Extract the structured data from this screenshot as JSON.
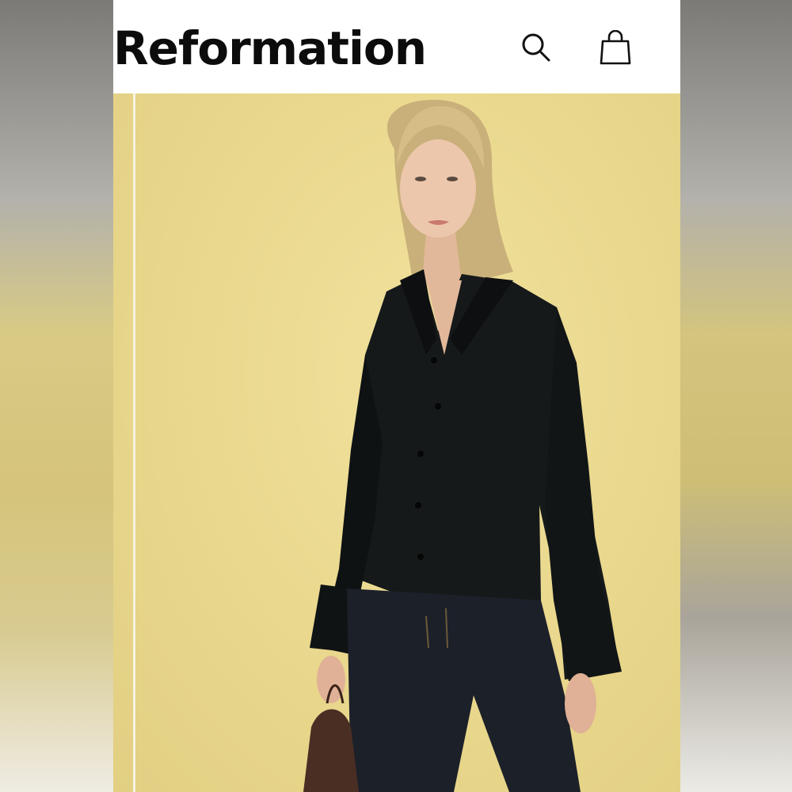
{
  "header": {
    "brand": "Reformation",
    "search_icon": "search-icon",
    "bag_icon": "shopping-bag-icon"
  },
  "hero": {
    "image": "product-photo-black-silk-button-up-shirt"
  },
  "colors": {
    "background": "#e9d98f",
    "header_bg": "#ffffff",
    "logo": "#0c0c0c"
  }
}
